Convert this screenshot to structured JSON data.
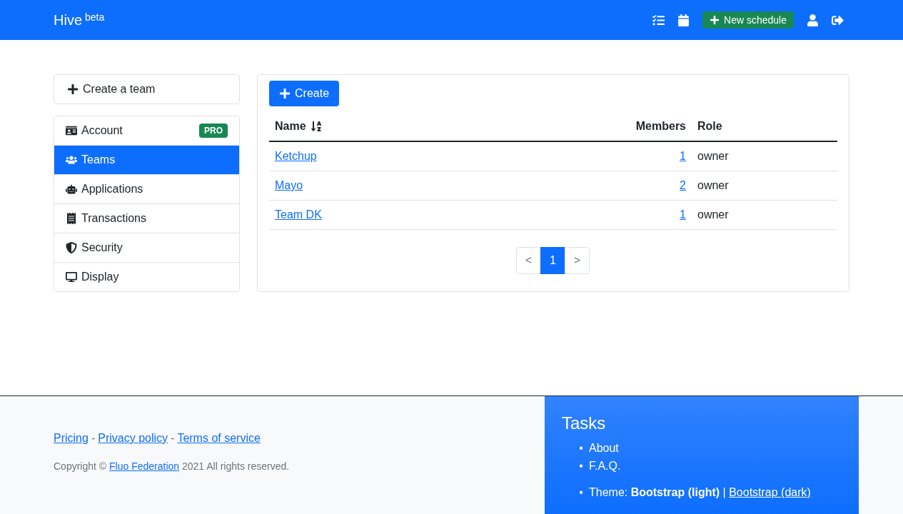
{
  "navbar": {
    "brand": "Hive",
    "brand_tag": "beta",
    "new_schedule": "New schedule"
  },
  "sidebar": {
    "create_button": "Create a team",
    "items": [
      {
        "label": "Account",
        "badge": "PRO",
        "selected": false
      },
      {
        "label": "Teams",
        "selected": true
      },
      {
        "label": "Applications",
        "selected": false
      },
      {
        "label": "Transactions",
        "selected": false
      },
      {
        "label": "Security",
        "selected": false
      },
      {
        "label": "Display",
        "selected": false
      }
    ]
  },
  "teams": {
    "create_button": "Create",
    "columns": [
      "Name",
      "Members",
      "Role"
    ],
    "rows": [
      {
        "name": "Ketchup",
        "members": "1",
        "role": "owner"
      },
      {
        "name": "Mayo",
        "members": "2",
        "role": "owner"
      },
      {
        "name": "Team DK",
        "members": "1",
        "role": "owner"
      }
    ],
    "pagination": [
      {
        "label": "<",
        "selected": false
      },
      {
        "label": "1",
        "selected": true
      },
      {
        "label": ">",
        "selected": false
      }
    ]
  },
  "footer": {
    "links": [
      "Pricing",
      "Privacy policy",
      "Terms of service"
    ],
    "separator": "-",
    "copyright_before": "Copyright ©",
    "copyright_link": "Fluo Federation",
    "copyright_after": "2021 All rights reserved.",
    "tasks": {
      "title": "Tasks",
      "bullet": "•",
      "links": [
        "About",
        "F.A.Q."
      ],
      "settings": [
        {
          "text": "Theme: **Bootstrap (light)** | ",
          "link": "Bootstrap (dark)"
        }
      ]
    }
  }
}
